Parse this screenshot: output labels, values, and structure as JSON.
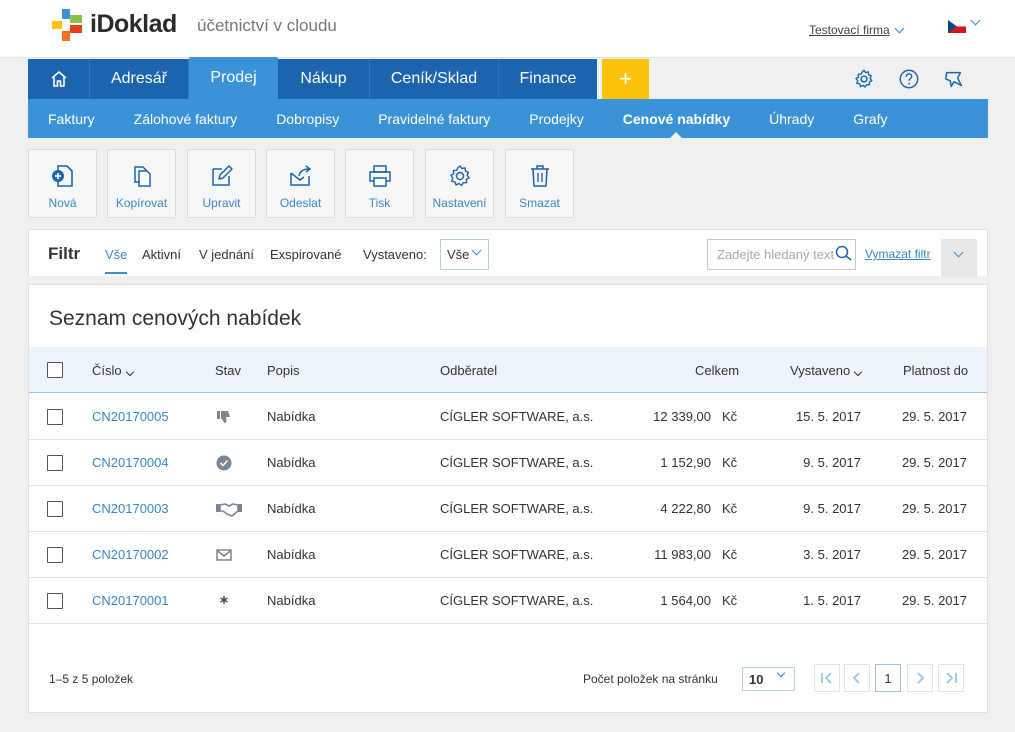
{
  "header": {
    "brand": "iDoklad",
    "tagline": "účetnictví v cloudu",
    "company": "Testovací firma",
    "language_flag": "czech-flag-icon"
  },
  "main_nav": {
    "home_icon": "home-icon",
    "items": [
      "Adresář",
      "Prodej",
      "Nákup",
      "Ceník/Sklad",
      "Finance"
    ],
    "active": "Prodej",
    "add_label": "+",
    "right_icons": [
      "gear-icon",
      "help-icon",
      "feedback-icon"
    ]
  },
  "sub_nav": {
    "items": [
      "Faktury",
      "Zálohové faktury",
      "Dobropisy",
      "Pravidelné faktury",
      "Prodejky",
      "Cenové nabídky",
      "Úhrady",
      "Grafy"
    ],
    "active": "Cenové nabídky"
  },
  "toolbar": {
    "new": "Nová",
    "copy": "Kopírovat",
    "edit": "Upravit",
    "send": "Odeslat",
    "print": "Tisk",
    "settings": "Nastavení",
    "delete": "Smazat"
  },
  "filter": {
    "title": "Filtr",
    "tabs": [
      "Vše",
      "Aktivní",
      "V jednání",
      "Exspirované"
    ],
    "active_tab": "Vše",
    "issued_label": "Vystaveno:",
    "issued_value": "Vše",
    "search_placeholder": "Zadejte hledaný text",
    "clear_label": "Vymazat filtr"
  },
  "list": {
    "title": "Seznam cenových nabídek",
    "columns": {
      "number": "Číslo",
      "state": "Stav",
      "description": "Popis",
      "customer": "Odběratel",
      "total": "Celkem",
      "issued": "Vystaveno",
      "valid_until": "Platnost do"
    },
    "rows": [
      {
        "number": "CN20170005",
        "state_icon": "thumbs-down-icon",
        "description": "Nabídka",
        "customer": "CÍGLER SOFTWARE, a.s.",
        "total": "12 339,00",
        "currency": "Kč",
        "issued": "15. 5. 2017",
        "valid_until": "29. 5. 2017"
      },
      {
        "number": "CN20170004",
        "state_icon": "check-circle-icon",
        "description": "Nabídka",
        "customer": "CÍGLER SOFTWARE, a.s.",
        "total": "1 152,90",
        "currency": "Kč",
        "issued": "9. 5. 2017",
        "valid_until": "29. 5. 2017"
      },
      {
        "number": "CN20170003",
        "state_icon": "handshake-icon",
        "description": "Nabídka",
        "customer": "CÍGLER SOFTWARE, a.s.",
        "total": "4 222,80",
        "currency": "Kč",
        "issued": "9. 5. 2017",
        "valid_until": "29. 5. 2017"
      },
      {
        "number": "CN20170002",
        "state_icon": "envelope-icon",
        "description": "Nabídka",
        "customer": "CÍGLER SOFTWARE, a.s.",
        "total": "11 983,00",
        "currency": "Kč",
        "issued": "3. 5. 2017",
        "valid_until": "29. 5. 2017"
      },
      {
        "number": "CN20170001",
        "state_icon": "asterisk-icon",
        "description": "Nabídka",
        "customer": "CÍGLER SOFTWARE, a.s.",
        "total": "1 564,00",
        "currency": "Kč",
        "issued": "1. 5. 2017",
        "valid_until": "29. 5. 2017"
      }
    ]
  },
  "pagination": {
    "count_text": "1–5 z 5 položek",
    "per_page_label": "Počet položek na stránku",
    "per_page_value": "10",
    "current_page": "1"
  },
  "colors": {
    "nav_dark": "#1c64ad",
    "nav_light": "#3b93d7",
    "accent_yellow": "#f9c20c",
    "link": "#3b86c7"
  }
}
